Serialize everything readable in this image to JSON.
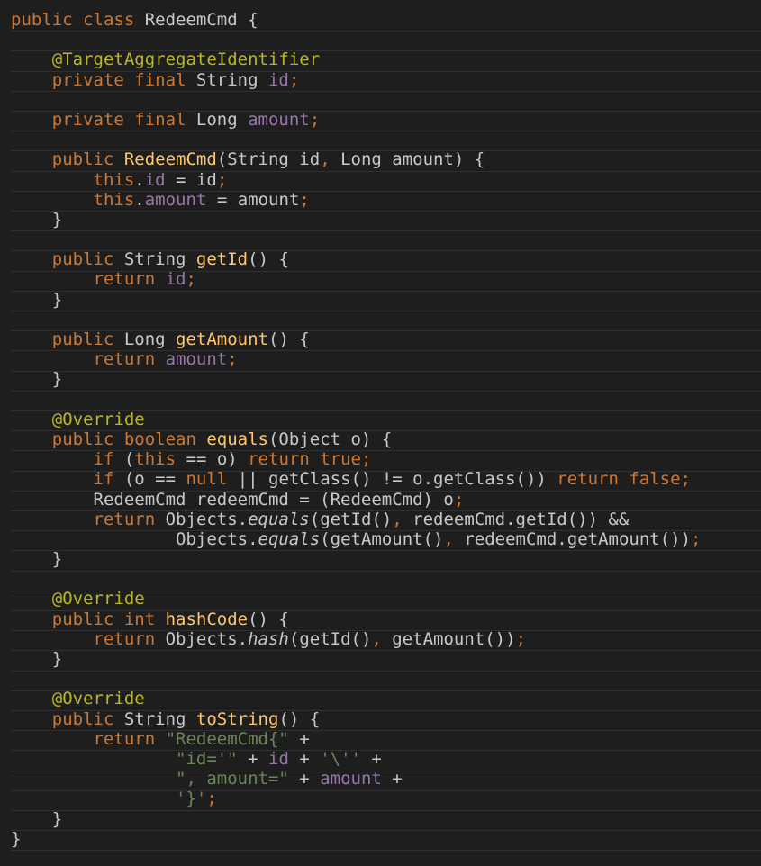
{
  "editor": {
    "lines": [
      [
        {
          "t": "kw",
          "v": "public class "
        },
        {
          "t": "plain",
          "v": "RedeemCmd {"
        }
      ],
      [],
      [
        {
          "t": "ann",
          "v": "    @TargetAggregateIdentifier"
        }
      ],
      [
        {
          "t": "kw",
          "v": "    private final "
        },
        {
          "t": "plain",
          "v": "String "
        },
        {
          "t": "field",
          "v": "id"
        },
        {
          "t": "punct",
          "v": ";"
        }
      ],
      [],
      [
        {
          "t": "kw",
          "v": "    private final "
        },
        {
          "t": "plain",
          "v": "Long "
        },
        {
          "t": "field",
          "v": "amount"
        },
        {
          "t": "punct",
          "v": ";"
        }
      ],
      [],
      [
        {
          "t": "kw",
          "v": "    public "
        },
        {
          "t": "fn",
          "v": "RedeemCmd"
        },
        {
          "t": "plain",
          "v": "(String id"
        },
        {
          "t": "punct",
          "v": ", "
        },
        {
          "t": "plain",
          "v": "Long amount) {"
        }
      ],
      [
        {
          "t": "kw",
          "v": "        this"
        },
        {
          "t": "plain",
          "v": "."
        },
        {
          "t": "field",
          "v": "id"
        },
        {
          "t": "plain",
          "v": " = id"
        },
        {
          "t": "punct",
          "v": ";"
        }
      ],
      [
        {
          "t": "kw",
          "v": "        this"
        },
        {
          "t": "plain",
          "v": "."
        },
        {
          "t": "field",
          "v": "amount"
        },
        {
          "t": "plain",
          "v": " = amount"
        },
        {
          "t": "punct",
          "v": ";"
        }
      ],
      [
        {
          "t": "plain",
          "v": "    }"
        }
      ],
      [],
      [
        {
          "t": "kw",
          "v": "    public "
        },
        {
          "t": "plain",
          "v": "String "
        },
        {
          "t": "fn",
          "v": "getId"
        },
        {
          "t": "plain",
          "v": "() {"
        }
      ],
      [
        {
          "t": "kw",
          "v": "        return "
        },
        {
          "t": "field",
          "v": "id"
        },
        {
          "t": "punct",
          "v": ";"
        }
      ],
      [
        {
          "t": "plain",
          "v": "    }"
        }
      ],
      [],
      [
        {
          "t": "kw",
          "v": "    public "
        },
        {
          "t": "plain",
          "v": "Long "
        },
        {
          "t": "fn",
          "v": "getAmount"
        },
        {
          "t": "plain",
          "v": "() {"
        }
      ],
      [
        {
          "t": "kw",
          "v": "        return "
        },
        {
          "t": "field",
          "v": "amount"
        },
        {
          "t": "punct",
          "v": ";"
        }
      ],
      [
        {
          "t": "plain",
          "v": "    }"
        }
      ],
      [],
      [
        {
          "t": "ann",
          "v": "    @Override"
        }
      ],
      [
        {
          "t": "kw",
          "v": "    public boolean "
        },
        {
          "t": "fn",
          "v": "equals"
        },
        {
          "t": "plain",
          "v": "(Object o) {"
        }
      ],
      [
        {
          "t": "kw",
          "v": "        if "
        },
        {
          "t": "plain",
          "v": "("
        },
        {
          "t": "kw",
          "v": "this "
        },
        {
          "t": "plain",
          "v": "== o) "
        },
        {
          "t": "kw",
          "v": "return true"
        },
        {
          "t": "punct",
          "v": ";"
        }
      ],
      [
        {
          "t": "kw",
          "v": "        if "
        },
        {
          "t": "plain",
          "v": "(o == "
        },
        {
          "t": "kw",
          "v": "null "
        },
        {
          "t": "plain",
          "v": "|| getClass() != o.getClass()) "
        },
        {
          "t": "kw",
          "v": "return false"
        },
        {
          "t": "punct",
          "v": ";"
        }
      ],
      [
        {
          "t": "plain",
          "v": "        RedeemCmd redeemCmd = (RedeemCmd) o"
        },
        {
          "t": "punct",
          "v": ";"
        }
      ],
      [
        {
          "t": "kw",
          "v": "        return "
        },
        {
          "t": "plain",
          "v": "Objects."
        },
        {
          "t": "call",
          "v": "equals"
        },
        {
          "t": "plain",
          "v": "(getId()"
        },
        {
          "t": "punct",
          "v": ", "
        },
        {
          "t": "plain",
          "v": "redeemCmd.getId()) &&"
        }
      ],
      [
        {
          "t": "plain",
          "v": "                Objects."
        },
        {
          "t": "call",
          "v": "equals"
        },
        {
          "t": "plain",
          "v": "(getAmount()"
        },
        {
          "t": "punct",
          "v": ", "
        },
        {
          "t": "plain",
          "v": "redeemCmd.getAmount())"
        },
        {
          "t": "punct",
          "v": ";"
        }
      ],
      [
        {
          "t": "plain",
          "v": "    }"
        }
      ],
      [],
      [
        {
          "t": "ann",
          "v": "    @Override"
        }
      ],
      [
        {
          "t": "kw",
          "v": "    public int "
        },
        {
          "t": "fn",
          "v": "hashCode"
        },
        {
          "t": "plain",
          "v": "() {"
        }
      ],
      [
        {
          "t": "kw",
          "v": "        return "
        },
        {
          "t": "plain",
          "v": "Objects."
        },
        {
          "t": "call",
          "v": "hash"
        },
        {
          "t": "plain",
          "v": "(getId()"
        },
        {
          "t": "punct",
          "v": ", "
        },
        {
          "t": "plain",
          "v": "getAmount())"
        },
        {
          "t": "punct",
          "v": ";"
        }
      ],
      [
        {
          "t": "plain",
          "v": "    }"
        }
      ],
      [],
      [
        {
          "t": "ann",
          "v": "    @Override"
        }
      ],
      [
        {
          "t": "kw",
          "v": "    public "
        },
        {
          "t": "plain",
          "v": "String "
        },
        {
          "t": "fn",
          "v": "toString"
        },
        {
          "t": "plain",
          "v": "() {"
        }
      ],
      [
        {
          "t": "kw",
          "v": "        return "
        },
        {
          "t": "str",
          "v": "\"RedeemCmd{\" "
        },
        {
          "t": "plain",
          "v": "+"
        }
      ],
      [
        {
          "t": "str",
          "v": "                \"id='\" "
        },
        {
          "t": "plain",
          "v": "+ "
        },
        {
          "t": "field",
          "v": "id "
        },
        {
          "t": "plain",
          "v": "+ "
        },
        {
          "t": "str",
          "v": "'\\'' "
        },
        {
          "t": "plain",
          "v": "+"
        }
      ],
      [
        {
          "t": "str",
          "v": "                \", amount=\" "
        },
        {
          "t": "plain",
          "v": "+ "
        },
        {
          "t": "field",
          "v": "amount "
        },
        {
          "t": "plain",
          "v": "+"
        }
      ],
      [
        {
          "t": "str",
          "v": "                '}'"
        },
        {
          "t": "punct",
          "v": ";"
        }
      ],
      [
        {
          "t": "plain",
          "v": "    }"
        }
      ],
      [
        {
          "t": "plain",
          "v": "}"
        }
      ]
    ],
    "colors": {
      "background": "#1e1e1e",
      "keyword": "#cc7832",
      "annotation": "#bbb529",
      "function": "#ffc66d",
      "field": "#9876aa",
      "string": "#6a8759",
      "text": "#c8c8c8"
    }
  }
}
